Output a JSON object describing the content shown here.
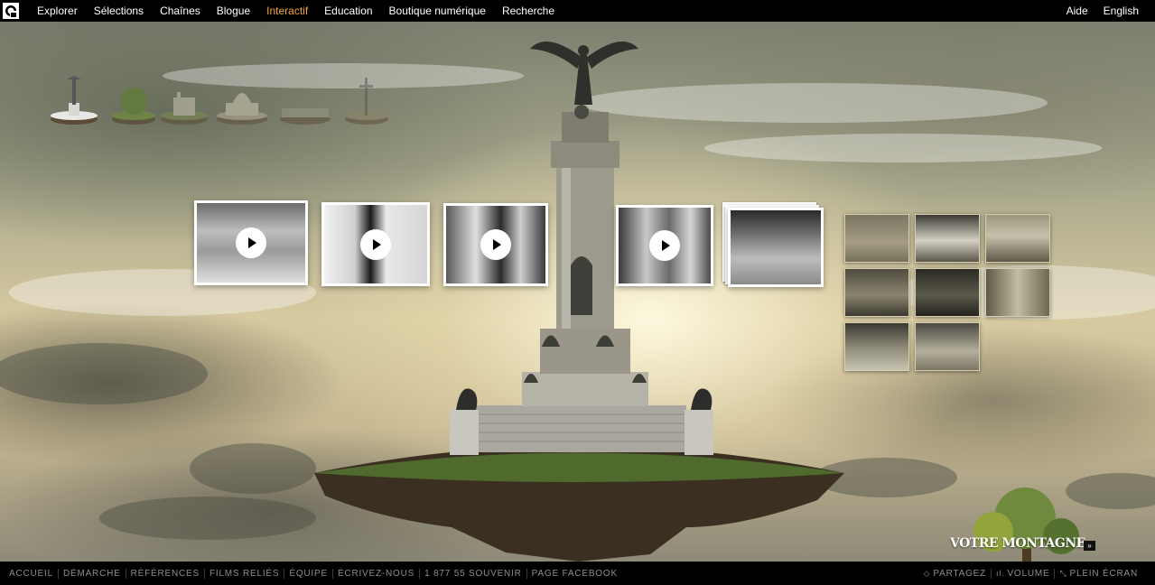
{
  "topnav": {
    "items": [
      "Explorer",
      "Sélections",
      "Chaînes",
      "Blogue",
      "Interactif",
      "Education",
      "Boutique numérique",
      "Recherche"
    ],
    "active": "Interactif",
    "right": [
      "Aide",
      "English"
    ]
  },
  "islands": [
    "monument-island",
    "tree-island",
    "ruins-island",
    "dome-island",
    "platform-island",
    "cross-island"
  ],
  "section_title": "VOTRE MONTAGNE",
  "section_button": "»",
  "footer": {
    "left": [
      "ACCUEIL",
      "DÉMARCHE",
      "RÉFÉRENCES",
      "FILMS RELIÉS",
      "ÉQUIPE",
      "ÉCRIVEZ-NOUS",
      "1 877 55 SOUVENIR",
      "PAGE FACEBOOK"
    ],
    "right": [
      {
        "label": "PARTAGEZ",
        "icon": "share-icon"
      },
      {
        "label": "VOLUME",
        "icon": "volume-icon"
      },
      {
        "label": "PLEIN ÉCRAN",
        "icon": "fullscreen-icon"
      }
    ]
  },
  "colors": {
    "active_nav": "#f2a63a",
    "topbar": "#000000",
    "footer_text": "#8e8e8e"
  }
}
